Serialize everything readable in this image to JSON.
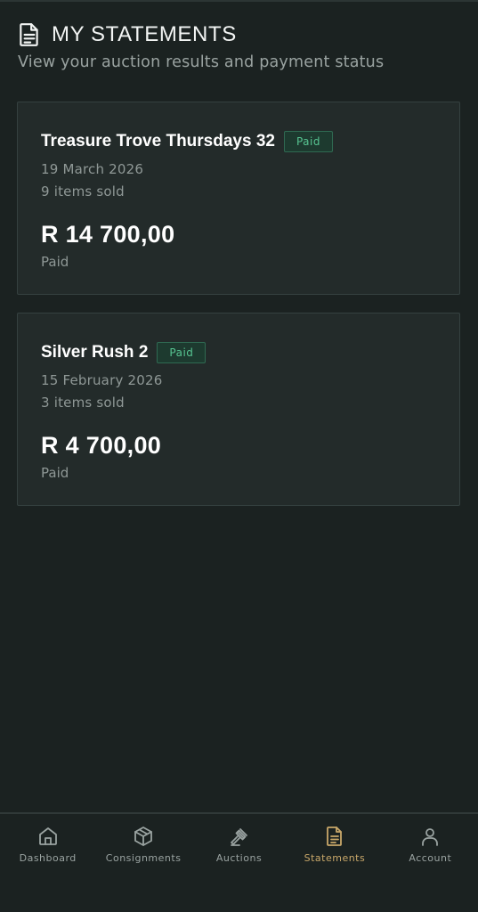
{
  "header": {
    "title": "MY STATEMENTS",
    "subtitle": "View your auction results and payment status",
    "icon": "document-icon"
  },
  "statements": [
    {
      "name": "Treasure Trove Thursdays 32",
      "badge": "Paid",
      "date": "19 March 2026",
      "items_sold": "9 items sold",
      "amount": "R 14 700,00",
      "status": "Paid"
    },
    {
      "name": "Silver Rush 2",
      "badge": "Paid",
      "date": "15 February 2026",
      "items_sold": "3 items sold",
      "amount": "R 4 700,00",
      "status": "Paid"
    }
  ],
  "nav": {
    "items": [
      {
        "label": "Dashboard",
        "icon": "home-icon"
      },
      {
        "label": "Consignments",
        "icon": "box-icon"
      },
      {
        "label": "Auctions",
        "icon": "gavel-icon"
      },
      {
        "label": "Statements",
        "icon": "document-icon",
        "active": true
      },
      {
        "label": "Account",
        "icon": "user-icon"
      }
    ]
  },
  "colors": {
    "background": "#1b2221",
    "card": "#232b2a",
    "accent": "#c9a86a",
    "paid_badge": "#57c491"
  }
}
